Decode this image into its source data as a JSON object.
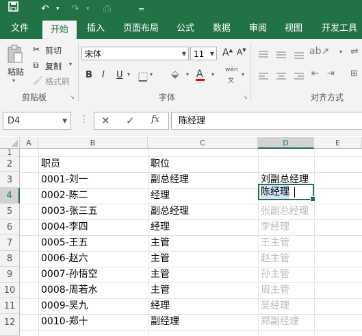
{
  "qat": {
    "save_icon": "save-icon",
    "undo_icon": "undo-icon",
    "redo_icon": "redo-icon",
    "preview_icon": "print-preview-icon",
    "customize": "="
  },
  "tabs": [
    "文件",
    "开始",
    "插入",
    "页面布局",
    "公式",
    "数据",
    "审阅",
    "视图",
    "开发工具"
  ],
  "ribbon": {
    "paste": "粘贴",
    "cut": "剪切",
    "copy": "复制",
    "format_painter": "格式刷",
    "clipboard_group": "剪贴板",
    "font_name": "宋体",
    "font_size": "11",
    "bold": "B",
    "italic": "I",
    "underline": "U",
    "font_color_letter": "A",
    "phonetic": "wén",
    "font_group": "字体",
    "align_group": "对齐方式",
    "font_color": "#ff0000"
  },
  "formula_bar": {
    "name_box": "D4",
    "cancel": "✕",
    "confirm": "✓",
    "fx": "fx",
    "content": "陈经理"
  },
  "sheet": {
    "columns": [
      "A",
      "B",
      "C",
      "D",
      "E"
    ],
    "rows": [
      "1",
      "2",
      "3",
      "4",
      "5",
      "6",
      "7",
      "8",
      "9",
      "10",
      "11",
      "12"
    ],
    "header": {
      "b": "职员",
      "c": "职位"
    },
    "data": [
      {
        "b": "0001-刘一",
        "c": "副总经理",
        "d": "刘副总经理"
      },
      {
        "b": "0002-陈二",
        "c": "经理",
        "d": "陈经理"
      },
      {
        "b": "0003-张三五",
        "c": "副总经理"
      },
      {
        "b": "0004-李四",
        "c": "经理"
      },
      {
        "b": "0005-王五",
        "c": "主管"
      },
      {
        "b": "0006-赵六",
        "c": "主管"
      },
      {
        "b": "0007-孙悟空",
        "c": "主管"
      },
      {
        "b": "0008-周若水",
        "c": "主管"
      },
      {
        "b": "0009-吴九",
        "c": "经理"
      },
      {
        "b": "0010-郑十",
        "c": "副经理"
      }
    ],
    "flash_fill_preview": [
      "张副总经理",
      "李经理",
      "王主管",
      "赵主管",
      "孙主管",
      "周主管",
      "吴经理",
      "郑副经理"
    ]
  },
  "colors": {
    "accent": "#217346",
    "selection": "#217346",
    "ghost_text": "#b8b8b8"
  }
}
